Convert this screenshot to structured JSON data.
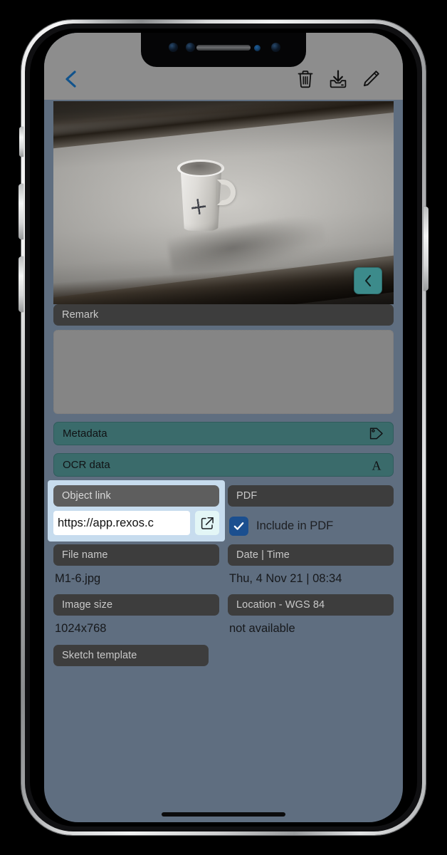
{
  "app": {
    "screen_background": "#5f6e80",
    "toolbar_background": "#8d8d8d",
    "accent_teal": "#3a6b6b",
    "accent_blue": "#1b4f8f",
    "highlight_blue": "#c7dcee"
  },
  "toolbar": {
    "back_icon": "chevron-left-icon",
    "delete_icon": "trash-icon",
    "download_icon": "download-icon",
    "edit_icon": "pencil-icon"
  },
  "photo": {
    "alt": "white coffee mug on a white desk",
    "prev_icon": "chevron-left-icon"
  },
  "remark": {
    "label": "Remark",
    "value": ""
  },
  "actions": [
    {
      "label": "Metadata",
      "icon": "tag-icon"
    },
    {
      "label": "OCR data",
      "icon": "text-a-icon"
    }
  ],
  "object_link": {
    "label": "Object link",
    "value": "https://app.rexos.c",
    "open_icon": "open-external-icon",
    "highlighted": true
  },
  "pdf": {
    "label": "PDF",
    "checkbox_label": "Include in PDF",
    "checked": true,
    "check_icon": "checkmark-icon"
  },
  "file_name": {
    "label": "File name",
    "value": "M1-6.jpg"
  },
  "date_time": {
    "label": "Date | Time",
    "value": "Thu, 4 Nov 21 | 08:34"
  },
  "image_size": {
    "label": "Image size",
    "value": "1024x768"
  },
  "location": {
    "label": "Location - WGS 84",
    "value": "not available"
  },
  "sketch_template": {
    "label": "Sketch template"
  }
}
